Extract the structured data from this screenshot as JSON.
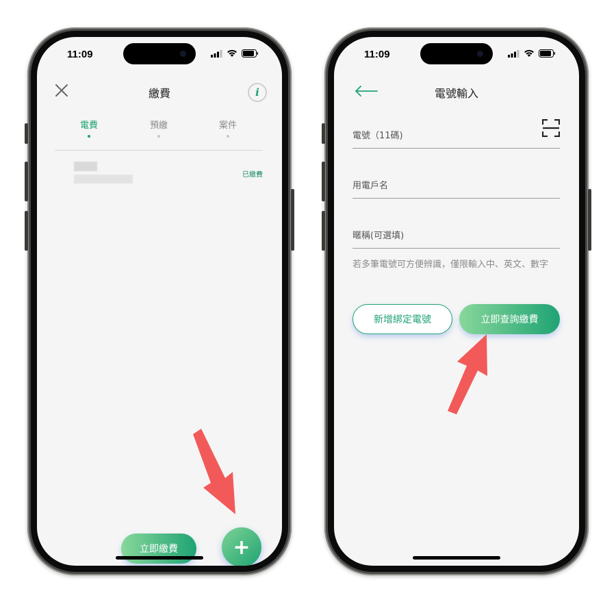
{
  "left_phone": {
    "status_time": "11:09",
    "nav_title": "繳費",
    "tabs": [
      {
        "label": "電費",
        "active": true
      },
      {
        "label": "預繳",
        "active": false
      },
      {
        "label": "案件",
        "active": false
      }
    ],
    "bill_status": "已繳費",
    "pay_now_label": "立即繳費",
    "add_button_label": "+"
  },
  "right_phone": {
    "status_time": "11:09",
    "nav_title": "電號輸入",
    "fields": [
      {
        "label": "電號（11碼)"
      },
      {
        "label": "用電戶名"
      },
      {
        "label": "暱稱(可選填)"
      }
    ],
    "hint": "若多筆電號可方便辨識，僅限輸入中、英文、數字",
    "add_bind_label": "新增綁定電號",
    "query_now_label": "立即查詢繳費"
  },
  "colors": {
    "accent": "#1fa374",
    "gradient_start": "#88d79a",
    "annotation_arrow": "#f25a5a"
  },
  "icons": [
    "close-icon",
    "info-icon",
    "back-arrow-icon",
    "scan-icon",
    "signal-icon",
    "wifi-icon",
    "battery-icon",
    "plus-icon"
  ]
}
